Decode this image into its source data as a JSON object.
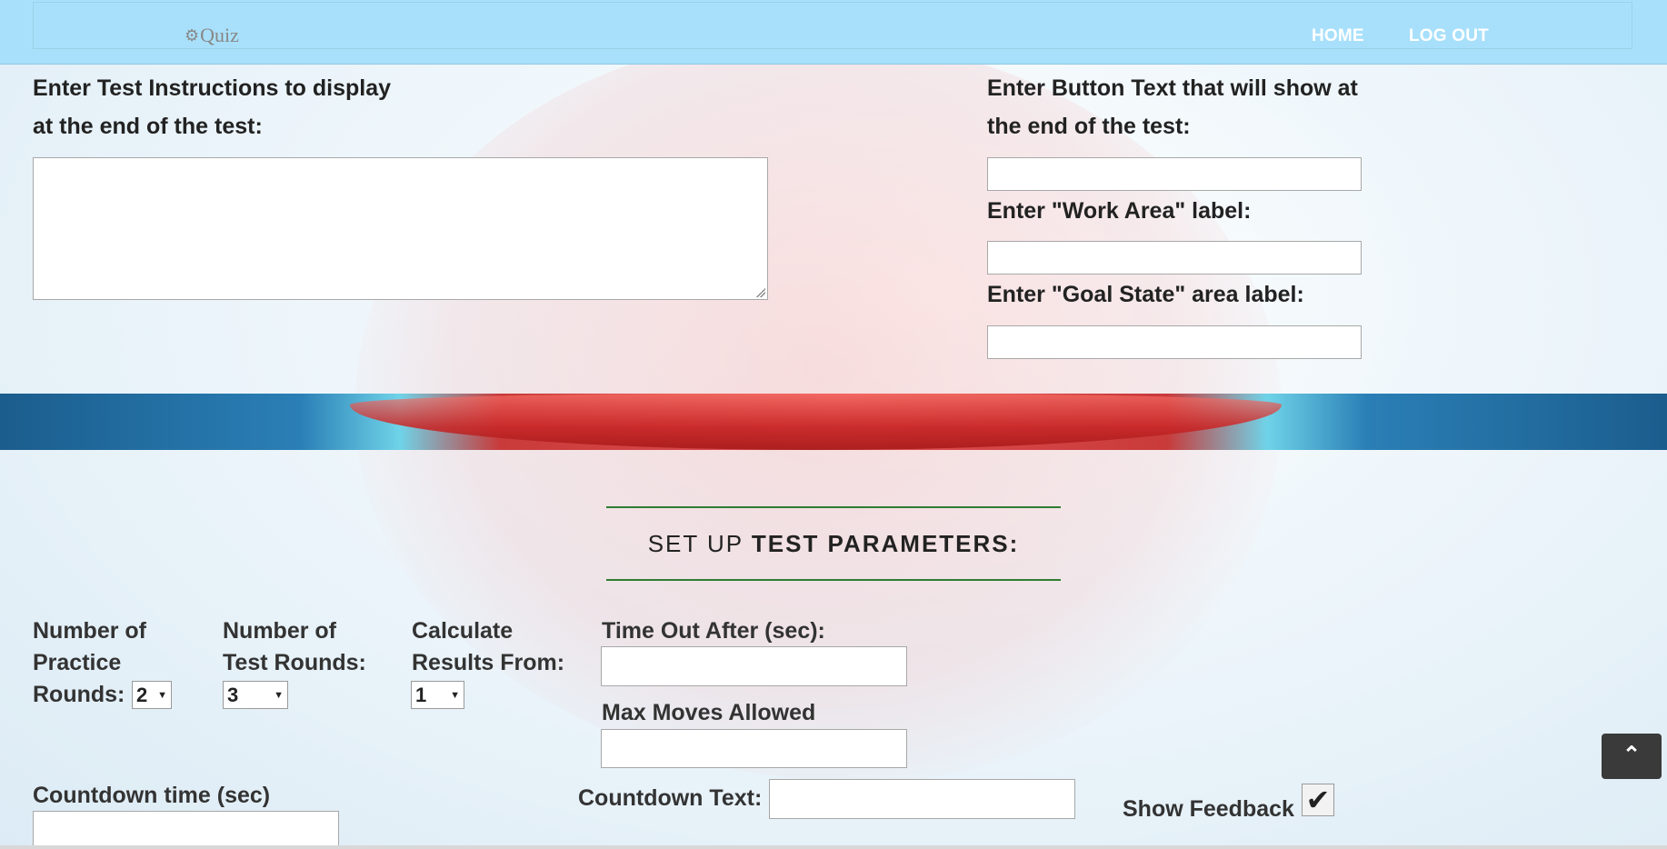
{
  "nav": {
    "brand": "Quiz",
    "brand_icon": "gears-icon",
    "links": [
      "HOME",
      "LOG OUT"
    ]
  },
  "instructions": {
    "end_instructions_label_line1": "Enter Test Instructions to display",
    "end_instructions_label_line2": "at the end of the test:",
    "end_instructions_value": "",
    "button_text_label_line1": "Enter Button Text that will show at",
    "button_text_label_line2": "the end of the test:",
    "button_text_value": "",
    "work_area_label": "Enter \"Work Area\" label:",
    "work_area_value": "",
    "goal_state_label": "Enter \"Goal State\" area label:",
    "goal_state_value": ""
  },
  "parameters": {
    "title_light": "SET UP ",
    "title_bold": "TEST PARAMETERS:",
    "practice_rounds_label": [
      "Number of",
      "Practice",
      "Rounds:"
    ],
    "practice_rounds_value": "2",
    "test_rounds_label": [
      "Number of",
      "Test Rounds:"
    ],
    "test_rounds_value": "3",
    "calculate_label": [
      "Calculate",
      "Results From:"
    ],
    "calculate_value": "1",
    "timeout_label": "Time Out After (sec):",
    "timeout_value": "",
    "max_moves_label": "Max Moves Allowed",
    "max_moves_value": "",
    "countdown_time_label": "Countdown time (sec)",
    "countdown_time_value": "",
    "countdown_text_label": "Countdown Text:",
    "countdown_text_value": "",
    "show_feedback_label": "Show Feedback",
    "show_feedback_checked": true
  },
  "icons": {
    "scroll_top": "chevron-up-icon",
    "checkmark": "checkmark-icon"
  }
}
